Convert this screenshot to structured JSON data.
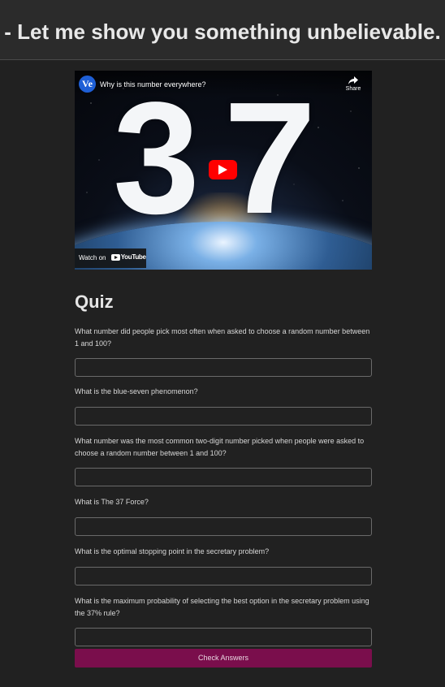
{
  "header": {
    "title": "- Let me show you something unbelievable."
  },
  "video": {
    "channel_logo_text": "Ve",
    "title": "Why is this number everywhere?",
    "share_label": "Share",
    "thumbnail_digits": [
      "3",
      "7"
    ],
    "watch_on_label": "Watch on",
    "youtube_label": "YouTube",
    "play_color": "#ff0000"
  },
  "quiz": {
    "title": "Quiz",
    "questions": [
      {
        "text": "What number did people pick most often when asked to choose a random number between 1 and 100?",
        "value": ""
      },
      {
        "text": "What is the blue-seven phenomenon?",
        "value": ""
      },
      {
        "text": "What number was the most common two-digit number picked when people were asked to choose a random number between 1 and 100?",
        "value": ""
      },
      {
        "text": "What is The 37 Force?",
        "value": ""
      },
      {
        "text": "What is the optimal stopping point in the secretary problem?",
        "value": ""
      },
      {
        "text": "What is the maximum probability of selecting the best option in the secretary problem using the 37% rule?",
        "value": ""
      }
    ],
    "submit_label": "Check Answers",
    "submit_color": "#7a0e4c"
  }
}
